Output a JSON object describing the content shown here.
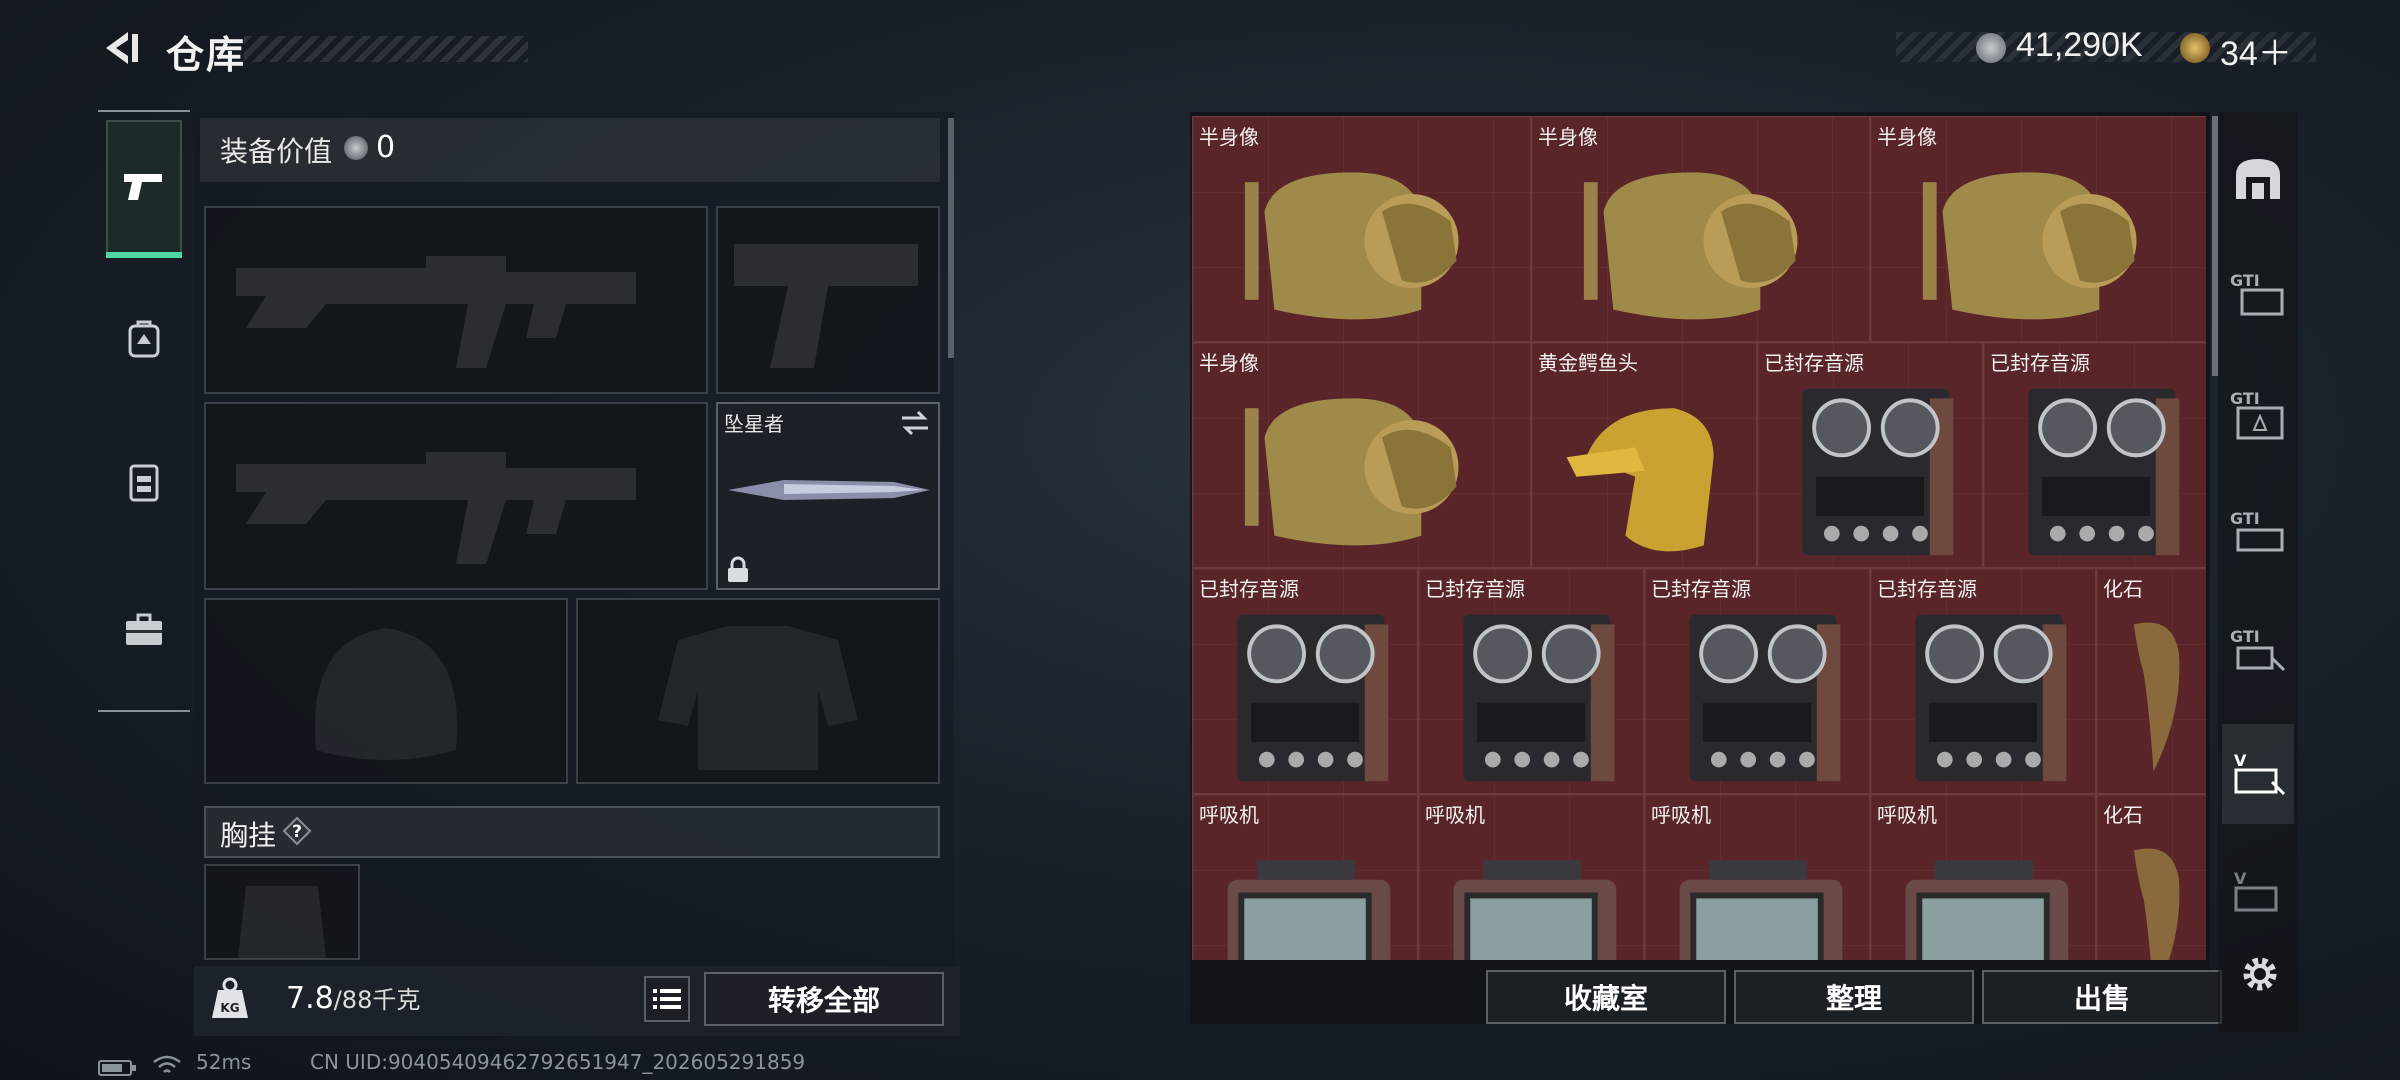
{
  "header": {
    "title": "仓库",
    "currency_amount": "41,290K",
    "token_amount": "34＋"
  },
  "left_nav": {
    "items": [
      "pistol-icon",
      "backpack-icon",
      "rig-icon",
      "case-icon"
    ]
  },
  "equipment": {
    "value_label": "装备价值",
    "value": "0",
    "melee_label": "坠星者",
    "chest_label": "胸挂",
    "chest_help": "?",
    "weight_current": "7.8",
    "weight_max": "/88千克",
    "transfer_all": "转移全部"
  },
  "storage": {
    "items": [
      {
        "label": "半身像",
        "kind": "bust"
      },
      {
        "label": "半身像",
        "kind": "bust"
      },
      {
        "label": "半身像",
        "kind": "bust"
      },
      {
        "label": "半身像",
        "kind": "bust"
      },
      {
        "label": "黄金鳄鱼头",
        "kind": "croc"
      },
      {
        "label": "已封存音源",
        "kind": "reel"
      },
      {
        "label": "已封存音源",
        "kind": "reel"
      },
      {
        "label": "已封存音源",
        "kind": "reel"
      },
      {
        "label": "已封存音源",
        "kind": "reel"
      },
      {
        "label": "已封存音源",
        "kind": "reel"
      },
      {
        "label": "已封存音源",
        "kind": "reel"
      },
      {
        "label": "化石",
        "kind": "fossil"
      },
      {
        "label": "呼吸机",
        "kind": "vent"
      },
      {
        "label": "呼吸机",
        "kind": "vent"
      },
      {
        "label": "呼吸机",
        "kind": "vent"
      },
      {
        "label": "呼吸机",
        "kind": "vent"
      },
      {
        "label": "化石",
        "kind": "fossil"
      }
    ],
    "buttons": {
      "collection": "收藏室",
      "organize": "整理",
      "sell": "出售"
    }
  },
  "right_nav": {
    "items": [
      "home-vault-icon",
      "gti-1-icon",
      "gti-2-icon",
      "gti-3-icon",
      "gti-4-icon",
      "v-1-icon",
      "v-2-icon"
    ]
  },
  "status": {
    "ping": "52ms",
    "uid": "CN UID:9040540946279265194​7_202605291859"
  },
  "colors": {
    "accent": "#4fd6a4",
    "cell_bg": "#5a2528"
  }
}
